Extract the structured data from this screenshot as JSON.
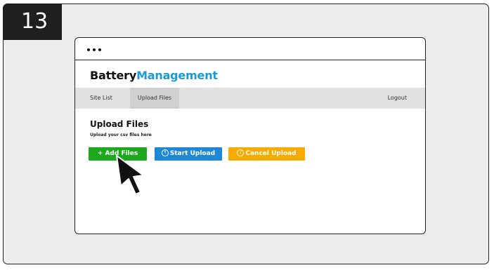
{
  "step": {
    "number": "13"
  },
  "app": {
    "title_part1": "Battery",
    "title_part2": "Management"
  },
  "nav": {
    "site_list": "Site List",
    "upload_files": "Upload Files",
    "logout": "Logout"
  },
  "page": {
    "title": "Upload Files",
    "subtitle": "Upload your csv files here"
  },
  "buttons": {
    "add_files": "+ Add Files",
    "start_upload": "Start Upload",
    "cancel_upload": "Cancel Upload",
    "start_icon": "upload-circle-icon",
    "cancel_icon": "cancel-circle-icon"
  },
  "colors": {
    "brand_accent": "#1a9bd4",
    "add_button": "#1ea81e",
    "start_button": "#1e88d6",
    "cancel_button": "#f7ab00"
  },
  "cursor": {
    "icon": "mouse-pointer-icon"
  }
}
